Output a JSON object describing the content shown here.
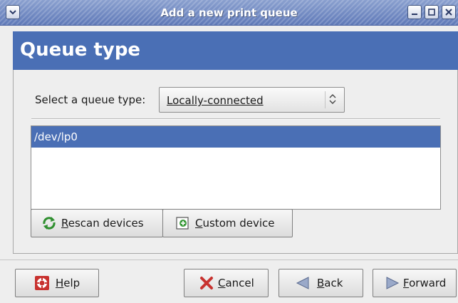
{
  "window": {
    "title": "Add a new print queue"
  },
  "header": {
    "title": "Queue type"
  },
  "queue_type": {
    "label": "Select a queue type:",
    "selected": "Locally-connected"
  },
  "devices": {
    "items": [
      "/dev/lp0"
    ],
    "selected_index": 0
  },
  "device_buttons": {
    "rescan": {
      "mnemonic": "R",
      "rest": "escan devices",
      "icon": "refresh-icon"
    },
    "custom": {
      "mnemonic": "C",
      "rest": "ustom device",
      "icon": "add-device-icon"
    }
  },
  "footer": {
    "help": {
      "mnemonic": "H",
      "rest": "elp",
      "icon": "lifebuoy-icon"
    },
    "cancel": {
      "mnemonic": "C",
      "rest": "ancel",
      "icon": "cancel-x-icon"
    },
    "back": {
      "mnemonic": "B",
      "rest": "ack",
      "icon": "arrow-left-icon"
    },
    "forward": {
      "mnemonic": "F",
      "rest": "orward",
      "icon": "arrow-right-icon"
    }
  },
  "colors": {
    "selection": "#4a6fb5",
    "title_bar": "#6f87c2",
    "window_bg": "#eeeeee"
  }
}
